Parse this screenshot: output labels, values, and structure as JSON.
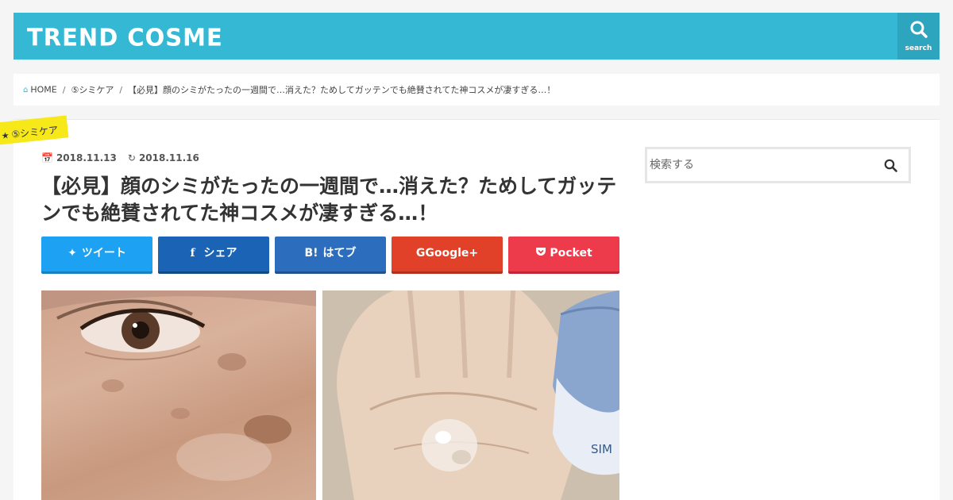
{
  "header": {
    "logo": "TREND COSME",
    "search_label": "search"
  },
  "breadcrumb": {
    "home": "HOME",
    "category": "⑤シミケア",
    "current": "【必見】顔のシミがたったの一週間で…消えた？ためしてガッテンでも絶賛されてた神コスメが凄すぎる…！"
  },
  "article": {
    "category_tag": "⑤シミケア",
    "published": "2018.11.13",
    "updated": "2018.11.16",
    "title": "【必見】顔のシミがたったの一週間で…消えた？ためしてガッテンでも絶賛されてた神コスメが凄すぎる…！"
  },
  "share": {
    "twitter": "ツイート",
    "facebook": "シェア",
    "hatena": "はてブ",
    "hatena_icon": "B!",
    "google": "Google+",
    "pocket": "Pocket"
  },
  "sidebar": {
    "search_placeholder": "検索する"
  },
  "colors": {
    "brand": "#35b8d3",
    "tag": "#f7e81a",
    "twitter": "#1da1f2",
    "facebook": "#1b64b5",
    "hatena": "#2c6ebd",
    "google": "#e04128",
    "pocket": "#ee3b4b"
  }
}
